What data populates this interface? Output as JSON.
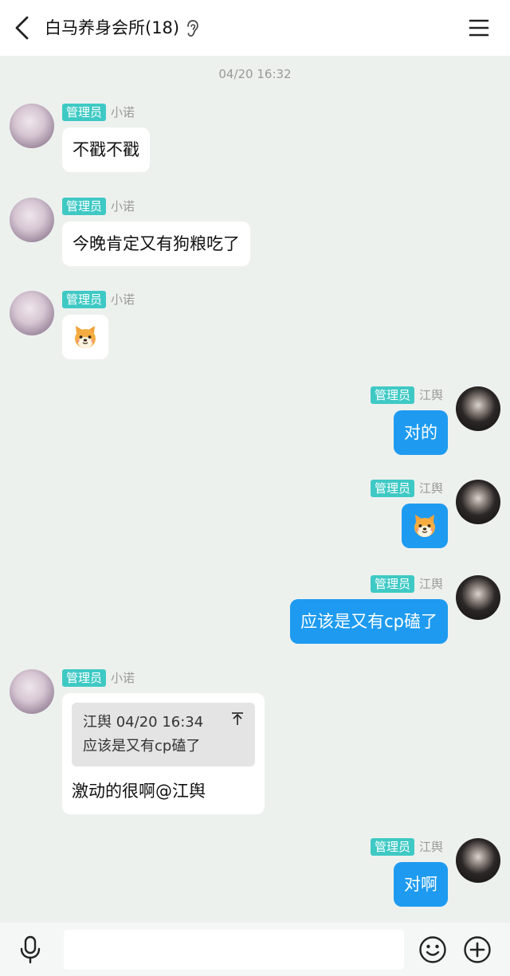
{
  "header": {
    "title": "白马养身会所(18)",
    "back_icon": "chevron-left-icon",
    "ear_icon": "ear-icon",
    "menu_icon": "hamburger-menu-icon"
  },
  "time_separator": "04/20 16:32",
  "messages": [
    {
      "side": "left",
      "role": "管理员",
      "nick": "小诺",
      "text": "不戳不戳"
    },
    {
      "side": "left",
      "role": "管理员",
      "nick": "小诺",
      "text": "今晚肯定又有狗粮吃了"
    },
    {
      "side": "left",
      "role": "管理员",
      "nick": "小诺",
      "emoji": "dog-emoji"
    },
    {
      "side": "right",
      "role": "管理员",
      "nick": "江舆",
      "text": "对的"
    },
    {
      "side": "right",
      "role": "管理员",
      "nick": "江舆",
      "emoji": "dog-emoji"
    },
    {
      "side": "right",
      "role": "管理员",
      "nick": "江舆",
      "text": "应该是又有cp磕了"
    },
    {
      "side": "left",
      "role": "管理员",
      "nick": "小诺",
      "quote": {
        "header": "江舆 04/20 16:34",
        "text": "应该是又有cp磕了"
      },
      "text": "激动的很啊@江舆"
    },
    {
      "side": "right",
      "role": "管理员",
      "nick": "江舆",
      "text": "对啊"
    }
  ],
  "input_bar": {
    "placeholder": "",
    "mic_icon": "microphone-icon",
    "emoji_icon": "smiley-icon",
    "plus_icon": "plus-circle-icon"
  },
  "colors": {
    "background": "#edf1ee",
    "badge": "#3fc9c4",
    "self_bubble": "#1e9bf0",
    "other_bubble": "#ffffff"
  }
}
